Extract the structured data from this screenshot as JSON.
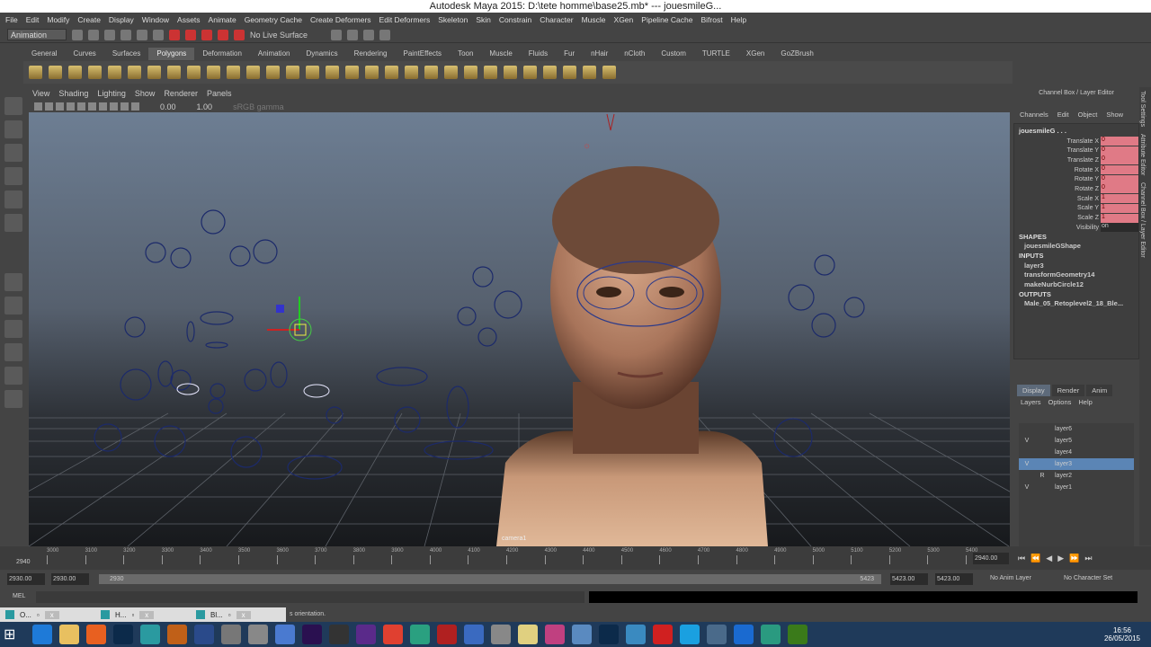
{
  "title": "Autodesk Maya 2015: D:\\tete homme\\base25.mb*   ---   jouesmileG...",
  "menu": [
    "File",
    "Edit",
    "Modify",
    "Create",
    "Display",
    "Window",
    "Assets",
    "Animate",
    "Geometry Cache",
    "Create Deformers",
    "Edit Deformers",
    "Skeleton",
    "Skin",
    "Constrain",
    "Character",
    "Muscle",
    "XGen",
    "Pipeline Cache",
    "Bifrost",
    "Help"
  ],
  "status": {
    "mode": "Animation",
    "live_surface": "No Live Surface"
  },
  "shelf_tabs": [
    "General",
    "Curves",
    "Surfaces",
    "Polygons",
    "Deformation",
    "Animation",
    "Dynamics",
    "Rendering",
    "PaintEffects",
    "Toon",
    "Muscle",
    "Fluids",
    "Fur",
    "nHair",
    "nCloth",
    "Custom",
    "TURTLE",
    "XGen",
    "GoZBrush"
  ],
  "shelf_active": "Polygons",
  "panel_menu": [
    "View",
    "Shading",
    "Lighting",
    "Show",
    "Renderer",
    "Panels"
  ],
  "panel_toolbar": {
    "value1": "0.00",
    "value2": "1.00",
    "colorspace": "sRGB gamma"
  },
  "viewport": {
    "camera_label": "camera1"
  },
  "channel_box": {
    "header": "Channel Box / Layer Editor",
    "menu": [
      "Channels",
      "Edit",
      "Object",
      "Show"
    ],
    "object": "jouesmileG . . .",
    "channels": [
      {
        "name": "Translate X",
        "value": "0"
      },
      {
        "name": "Translate Y",
        "value": "0"
      },
      {
        "name": "Translate Z",
        "value": "0"
      },
      {
        "name": "Rotate X",
        "value": "0"
      },
      {
        "name": "Rotate Y",
        "value": "0"
      },
      {
        "name": "Rotate Z",
        "value": "0"
      },
      {
        "name": "Scale X",
        "value": "1"
      },
      {
        "name": "Scale Y",
        "value": "1"
      },
      {
        "name": "Scale Z",
        "value": "1"
      },
      {
        "name": "Visibility",
        "value": "on"
      }
    ],
    "shapes_label": "SHAPES",
    "shape": "jouesmileGShape",
    "inputs_label": "INPUTS",
    "inputs": [
      "layer3",
      "transformGeometry14",
      "makeNurbCircle12"
    ],
    "outputs_label": "OUTPUTS",
    "output": "Male_05_Retoplevel2_18_Ble..."
  },
  "vertical_tabs": [
    "Tool Settings",
    "Attribute Editor",
    "Channel Box / Layer Editor"
  ],
  "layer_editor": {
    "tabs": [
      "Display",
      "Render",
      "Anim"
    ],
    "menu": [
      "Layers",
      "Options",
      "Help"
    ],
    "layers": [
      {
        "v": "",
        "r": "",
        "name": "layer6"
      },
      {
        "v": "V",
        "r": "",
        "name": "layer5"
      },
      {
        "v": "",
        "r": "",
        "name": "layer4"
      },
      {
        "v": "V",
        "r": "",
        "name": "layer3",
        "selected": true
      },
      {
        "v": "",
        "r": "R",
        "name": "layer2"
      },
      {
        "v": "V",
        "r": "",
        "name": "layer1"
      }
    ]
  },
  "timeline": {
    "ticks": [
      "3000",
      "3100",
      "3200",
      "3300",
      "3400",
      "3500",
      "3600",
      "3700",
      "3800",
      "3900",
      "4000",
      "4100",
      "4200",
      "4300",
      "4400",
      "4500",
      "4600",
      "4700",
      "4800",
      "4900",
      "5000",
      "5100",
      "5200",
      "5300",
      "5400"
    ],
    "current_left": "2940",
    "current_frame": "2940.00"
  },
  "range": {
    "start": "2930.00",
    "anim_start": "2930.00",
    "slider_start": "2930",
    "slider_end": "5423",
    "anim_end": "5423.00",
    "end": "5423.00",
    "anim_layer": "No Anim Layer",
    "character_set": "No Character Set"
  },
  "mel": {
    "label": "MEL"
  },
  "help_line": "s orientation.",
  "minimized_windows": [
    "O...",
    "H...",
    "Bl..."
  ],
  "clock": {
    "time": "16:56",
    "date": "26/05/2015"
  }
}
